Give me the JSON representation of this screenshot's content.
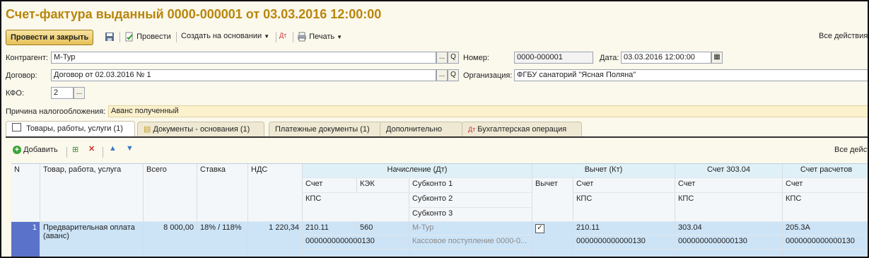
{
  "title": "Счет-фактура выданный 0000-000001 от 03.03.2016 12:00:00",
  "toolbar": {
    "post_close": "Провести и закрыть",
    "post": "Провести",
    "create_based": "Создать на основании",
    "print": "Печать",
    "all_actions": "Все действия"
  },
  "form": {
    "contragent_label": "Контрагент:",
    "contragent_value": "М-Тур",
    "contract_label": "Договор:",
    "contract_value": "Договор от 02.03.2016 № 1",
    "kfo_label": "КФО:",
    "kfo_value": "2",
    "number_label": "Номер:",
    "number_value": "0000-000001",
    "date_label": "Дата:",
    "date_value": "03.03.2016 12:00:00",
    "org_label": "Организация:",
    "org_value": "ФГБУ санаторий \"Ясная Поляна\"",
    "reason_label": "Причина налогообложения:",
    "reason_value": "Аванс полученный",
    "ellipsis": "...",
    "search": "Q"
  },
  "tabs": [
    {
      "label": "Товары, работы, услуги (1)"
    },
    {
      "label": "Документы - основания (1)"
    },
    {
      "label": "Платежные документы (1)"
    },
    {
      "label": "Дополнительно"
    },
    {
      "label": "Бухгалтерская операция"
    }
  ],
  "table_toolbar": {
    "add": "Добавить",
    "all_actions": "Все дейст"
  },
  "table": {
    "headers": {
      "n": "N",
      "item": "Товар, работа, услуга",
      "total": "Всего",
      "rate": "Ставка",
      "vat": "НДС",
      "accrual": "Начисление (Дт)",
      "deduction": "Вычет (Кт)",
      "acc30304": "Счет 303.04",
      "acc_settle": "Счет расчетов",
      "account": "Счет",
      "kek": "КЭК",
      "sub1": "Субконто 1",
      "sub2": "Субконто 2",
      "sub3": "Субконто 3",
      "deduct": "Вычет",
      "kps": "КПС"
    },
    "row": {
      "n": "1",
      "item": "Предварительная оплата (аванс)",
      "total": "8 000,00",
      "rate": "18% / 118%",
      "vat": "1 220,34",
      "acc_dt": "210.11",
      "kek": "560",
      "sub1": "М-Тур",
      "sub2": "Кассовое поступление 0000-0...",
      "kps_dt": "0000000000000130",
      "deduct_checked": true,
      "acc_kt": "210.11",
      "kps_kt": "0000000000000130",
      "acc_30304": "303.04",
      "kps_30304": "0000000000000130",
      "acc_settle": "205.3А",
      "kps_settle": "0000000000000130"
    }
  }
}
